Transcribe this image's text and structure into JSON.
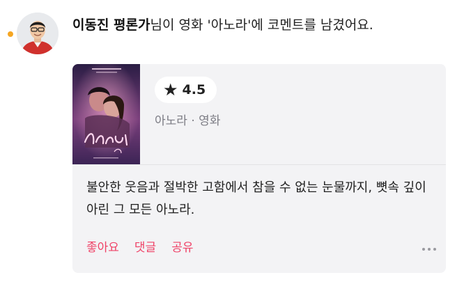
{
  "activity": {
    "username": "이동진 평론가",
    "action_text": "님이 영화 '아노라'에 코멘트를 남겼어요."
  },
  "card": {
    "rating_star": "★",
    "rating_value": "4.5",
    "movie_meta": "아노라 · 영화",
    "comment": "불안한 웃음과 절박한 고함에서 참을 수 없는 눈물까지, 뼛속 깊이 아린 그 모든 아노라.",
    "actions": {
      "like": "좋아요",
      "reply": "댓글",
      "share": "공유"
    }
  },
  "colors": {
    "unread_dot": "#f5a623",
    "action_accent": "#ef4368",
    "card_background": "#f3f3f5"
  }
}
